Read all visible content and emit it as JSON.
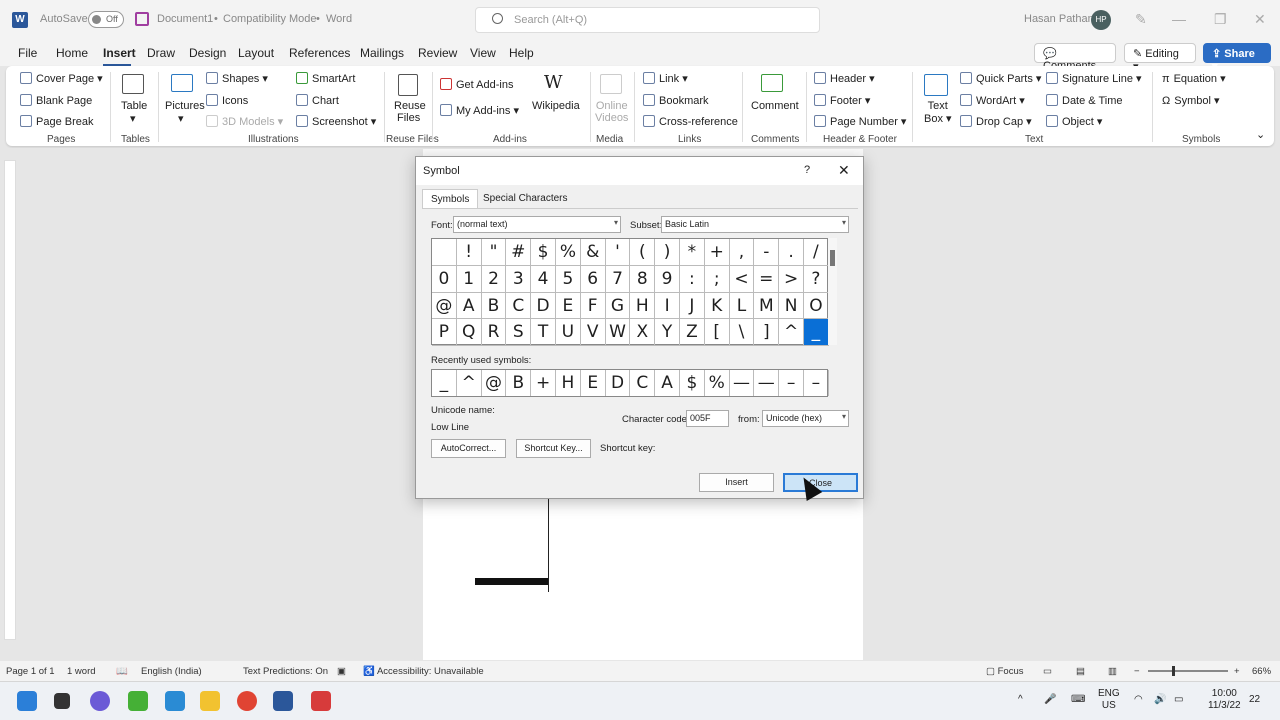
{
  "titlebar": {
    "autosave": "AutoSave",
    "toggle": "Off",
    "doc": "Document1",
    "mode": "Compatibility Mode",
    "app": "Word",
    "search_placeholder": "Search (Alt+Q)",
    "user": "Hasan Pathan",
    "initials": "HP"
  },
  "menu": {
    "items": [
      "File",
      "Home",
      "Insert",
      "Draw",
      "Design",
      "Layout",
      "References",
      "Mailings",
      "Review",
      "View",
      "Help"
    ],
    "comments": "Comments",
    "editing": "Editing",
    "share": "Share"
  },
  "ribbon": {
    "pages": {
      "cover": "Cover Page",
      "blank": "Blank Page",
      "break": "Page Break",
      "label": "Pages"
    },
    "tables": {
      "table": "Table",
      "label": "Tables"
    },
    "illustrations": {
      "pictures": "Pictures",
      "shapes": "Shapes",
      "icons": "Icons",
      "models": "3D Models",
      "smartart": "SmartArt",
      "chart": "Chart",
      "screenshot": "Screenshot",
      "label": "Illustrations"
    },
    "reuse": {
      "btn1": "Reuse",
      "btn2": "Files",
      "label": "Reuse Files"
    },
    "addins": {
      "get": "Get Add-ins",
      "my": "My Add-ins",
      "wiki": "Wikipedia",
      "label": "Add-ins"
    },
    "media": {
      "online1": "Online",
      "online2": "Videos",
      "label": "Media"
    },
    "links": {
      "link": "Link",
      "bookmark": "Bookmark",
      "xref": "Cross-reference",
      "label": "Links"
    },
    "comments": {
      "comment": "Comment",
      "label": "Comments"
    },
    "hf": {
      "header": "Header",
      "footer": "Footer",
      "pagenum": "Page Number",
      "label": "Header & Footer"
    },
    "text": {
      "textbox1": "Text",
      "textbox2": "Box",
      "quickparts": "Quick Parts",
      "wordart": "WordArt",
      "dropcap": "Drop Cap",
      "sigline": "Signature Line",
      "datetime": "Date & Time",
      "object": "Object",
      "label": "Text"
    },
    "symbols": {
      "equation": "Equation",
      "symbol": "Symbol",
      "label": "Symbols"
    }
  },
  "dialog": {
    "title": "Symbol",
    "help": "?",
    "close_x": "✕",
    "tabs": [
      "Symbols",
      "Special Characters"
    ],
    "font_label": "Font:",
    "font_value": "(normal text)",
    "subset_label": "Subset:",
    "subset_value": "Basic Latin",
    "grid": [
      [
        " ",
        "!",
        "\"",
        "#",
        "$",
        "%",
        "&",
        "'",
        "(",
        ")",
        "*",
        "+",
        ",",
        "-",
        ".",
        "/"
      ],
      [
        "0",
        "1",
        "2",
        "3",
        "4",
        "5",
        "6",
        "7",
        "8",
        "9",
        ":",
        ";",
        "<",
        "=",
        ">",
        "?"
      ],
      [
        "@",
        "A",
        "B",
        "C",
        "D",
        "E",
        "F",
        "G",
        "H",
        "I",
        "J",
        "K",
        "L",
        "M",
        "N",
        "O"
      ],
      [
        "P",
        "Q",
        "R",
        "S",
        "T",
        "U",
        "V",
        "W",
        "X",
        "Y",
        "Z",
        "[",
        "\\",
        "]",
        "^",
        "_"
      ]
    ],
    "recent_label": "Recently used symbols:",
    "recent": [
      "_",
      "^",
      "@",
      "B",
      "+",
      "H",
      "E",
      "D",
      "C",
      "A",
      "$",
      "%",
      "—",
      "—",
      "–",
      "–"
    ],
    "unicode_name_label": "Unicode name:",
    "unicode_name": "Low Line",
    "char_code_label": "Character code:",
    "char_code": "005F",
    "from_label": "from:",
    "from_value": "Unicode (hex)",
    "autocorrect": "AutoCorrect...",
    "shortcut_key_btn": "Shortcut Key...",
    "shortcut_key_label": "Shortcut key:",
    "insert": "Insert",
    "close": "Close"
  },
  "status": {
    "page": "Page 1 of 1",
    "words": "1 word",
    "lang": "English (India)",
    "predictions": "Text Predictions: On",
    "accessibility": "Accessibility: Unavailable",
    "focus": "Focus",
    "zoom": "66%"
  },
  "taskbar": {
    "lang1": "ENG",
    "lang2": "US",
    "time": "10:00",
    "date": "11/3/22",
    "notif": "22"
  }
}
